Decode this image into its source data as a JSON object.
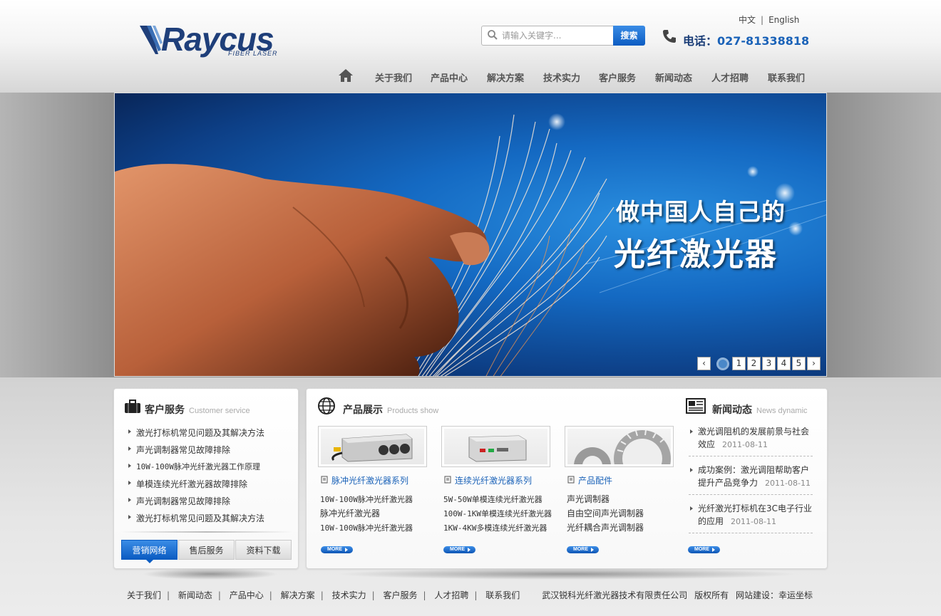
{
  "header": {
    "logo_text": "Raycus",
    "logo_sub": "FIBER LASER",
    "lang": [
      "中文",
      "English"
    ],
    "search": {
      "placeholder": "请输入关键字...",
      "button": "搜索"
    },
    "phone_label": "电话：",
    "phone_number": "027-81338818"
  },
  "nav": {
    "items": [
      "关于我们",
      "产品中心",
      "解决方案",
      "技术实力",
      "客户服务",
      "新闻动态",
      "人才招聘",
      "联系我们"
    ]
  },
  "banner": {
    "line1": "做中国人自己的",
    "line2": "光纤激光器",
    "pages": [
      "1",
      "2",
      "3",
      "4",
      "5"
    ]
  },
  "service": {
    "title": "客户服务",
    "subtitle": "Customer service",
    "items": [
      "激光打标机常见问题及其解决方法",
      "声光调制器常见故障排除",
      "10W-100W脉冲光纤激光器工作原理",
      "单模连续光纤激光器故障排除",
      "声光调制器常见故障排除",
      "激光打标机常见问题及其解决方法"
    ],
    "tabs": [
      "营销网络",
      "售后服务",
      "资料下载"
    ]
  },
  "products": {
    "title": "产品展示",
    "subtitle": "Products show",
    "columns": [
      {
        "category": "脉冲光纤激光器系列",
        "items": [
          "10W-100W脉冲光纤激光器",
          "脉冲光纤激光器",
          "10W-100W脉冲光纤激光器"
        ]
      },
      {
        "category": "连续光纤激光器系列",
        "items": [
          "5W-50W单模连续光纤激光器",
          "100W-1KW单模连续光纤激光器",
          "1KW-4KW多模连续光纤激光器"
        ]
      },
      {
        "category": "产品配件",
        "items": [
          "声光调制器",
          "自由空间声光调制器",
          "光纤耦合声光调制器"
        ]
      }
    ],
    "more": "MORE"
  },
  "news": {
    "title": "新闻动态",
    "subtitle": "News dynamic",
    "items": [
      {
        "text": "激光调阻机的发展前景与社会效应",
        "date": "2011-08-11"
      },
      {
        "text": "成功案例：激光调阻帮助客户提升产品竞争力",
        "date": "2011-08-11"
      },
      {
        "text": "光纤激光打标机在3C电子行业的应用",
        "date": "2011-08-11"
      }
    ],
    "more": "MORE"
  },
  "footer": {
    "links": [
      "关于我们",
      "新闻动态",
      "产品中心",
      "解决方案",
      "技术实力",
      "客户服务",
      "人才招聘",
      "联系我们"
    ],
    "company": "武汉锐科光纤激光器技术有限责任公司",
    "rights": "版权所有",
    "credit": "网站建设：幸运坐标"
  },
  "colors": {
    "brand": "#1f3f7a",
    "accent": "#1a62b8",
    "button": "#0b5cc2"
  }
}
